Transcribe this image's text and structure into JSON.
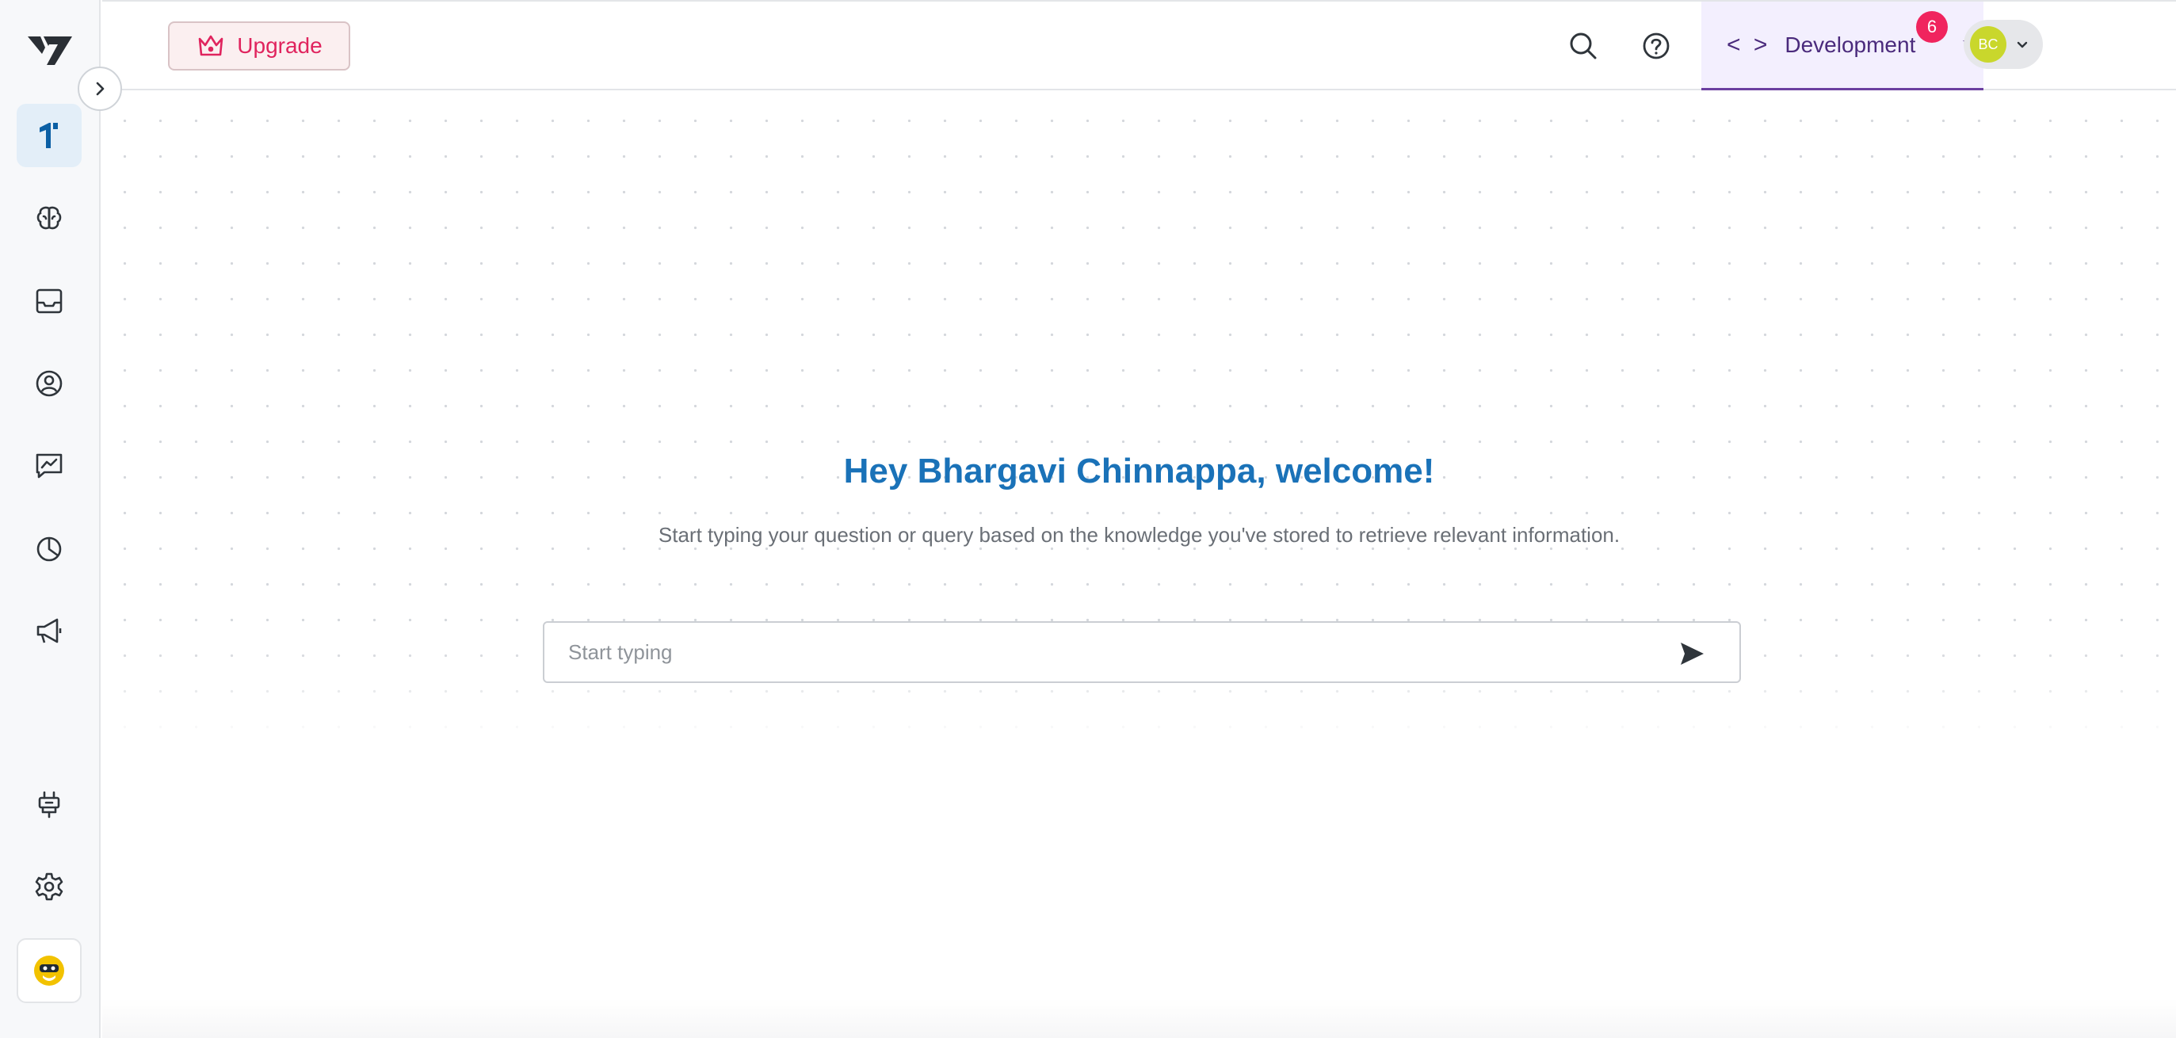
{
  "header": {
    "upgrade_label": "Upgrade",
    "environment_label": "Development",
    "environment_code_glyph": "< >",
    "notification_count": "6",
    "avatar_initials": "BC"
  },
  "main": {
    "welcome_text": "Hey Bhargavi Chinnappa, welcome!",
    "subtitle": "Start typing your question or query based on the knowledge you've stored to retrieve relevant information.",
    "search_placeholder": "Start typing"
  },
  "sidebar": {
    "items": [
      {
        "icon": "knowledge-icon",
        "active": true
      },
      {
        "icon": "brain-icon"
      },
      {
        "icon": "inbox-icon"
      },
      {
        "icon": "user-circle-icon"
      },
      {
        "icon": "chart-message-icon"
      },
      {
        "icon": "pie-chart-icon"
      },
      {
        "icon": "megaphone-icon"
      },
      {
        "icon": "plug-icon"
      },
      {
        "icon": "gear-icon"
      },
      {
        "icon": "bot-avatar-icon"
      }
    ]
  },
  "colors": {
    "accent_blue": "#1a72b8",
    "upgrade_red": "#e0245e",
    "env_purple": "#4a2a7c",
    "badge": "#f0245e",
    "avatar": "#c9d72c"
  }
}
